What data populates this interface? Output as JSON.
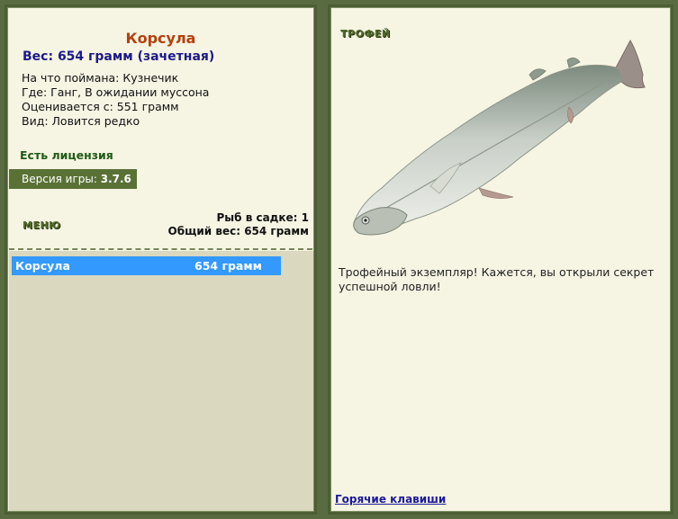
{
  "fish": {
    "name": "Корсула",
    "weight_line": "Вес: 654 грамм (зачетная)",
    "caught_on": "На что поймана: Кузнечик",
    "location": "Где: Ганг, В ожидании муссона",
    "valued_from": "Оценивается с: 551 грамм",
    "rarity": "Вид: Ловится редко"
  },
  "license": "Есть лицензия",
  "version": {
    "label": "Версия игры: ",
    "value": "3.7.6"
  },
  "menu_label": "МЕНЮ",
  "keepnet": {
    "count_line": "Рыб в садке: 1",
    "total_line": "Общий вес: 654 грамм",
    "items": [
      {
        "name": "Корсула",
        "weight": "654 грамм"
      }
    ]
  },
  "trophy": {
    "title": "ТРОФЕЙ",
    "text": "Трофейный экземпляр! Кажется, вы открыли секрет успешной ловли!",
    "image_icon": "fish-icon"
  },
  "hotkeys_label": "Горячие клавиши",
  "colors": {
    "background": "#596b41",
    "panel": "#f6f4e3",
    "fish_name": "#b5400e",
    "weight": "#1c1a8a",
    "selection": "#3399ff"
  }
}
